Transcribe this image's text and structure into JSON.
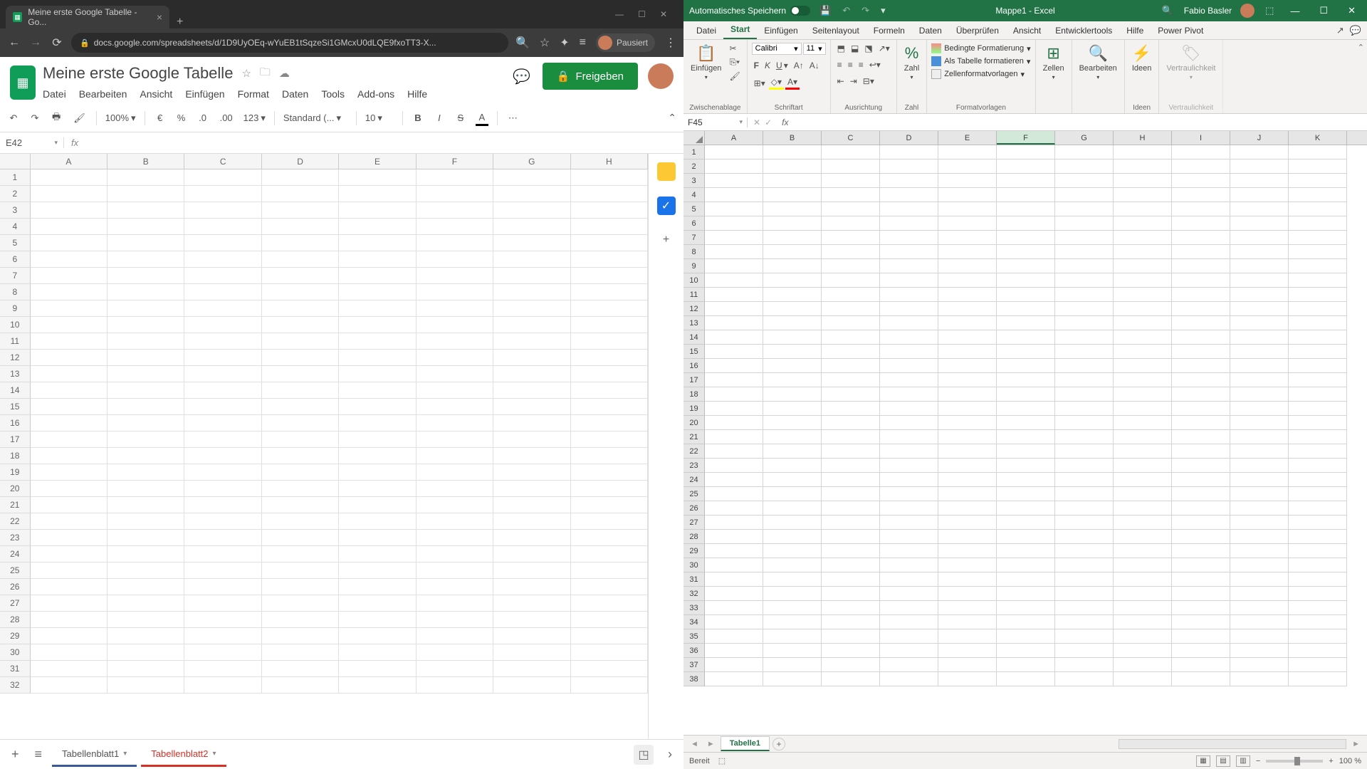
{
  "chrome": {
    "tab_title": "Meine erste Google Tabelle - Go...",
    "url": "docs.google.com/spreadsheets/d/1D9UyOEq-wYuEB1tSqzeSi1GMcxU0dLQE9fxoTT3-X...",
    "pausiert": "Pausiert"
  },
  "gs": {
    "title": "Meine erste Google Tabelle",
    "menus": [
      "Datei",
      "Bearbeiten",
      "Ansicht",
      "Einfügen",
      "Format",
      "Daten",
      "Tools",
      "Add-ons",
      "Hilfe"
    ],
    "share": "Freigeben",
    "toolbar": {
      "zoom": "100%",
      "currency": "€",
      "percent": "%",
      "dec_dec": ".0",
      "inc_dec": ".00",
      "numfmt": "123",
      "fontfmt": "Standard (...",
      "fontsize": "10"
    },
    "namebox": "E42",
    "cols": [
      "A",
      "B",
      "C",
      "D",
      "E",
      "F",
      "G",
      "H"
    ],
    "rows": 32,
    "sheet_tabs": [
      "Tabellenblatt1",
      "Tabellenblatt2"
    ]
  },
  "xl": {
    "autosave": "Automatisches Speichern",
    "doc_title": "Mappe1 - Excel",
    "user": "Fabio Basler",
    "ribbon_tabs": [
      "Datei",
      "Start",
      "Einfügen",
      "Seitenlayout",
      "Formeln",
      "Daten",
      "Überprüfen",
      "Ansicht",
      "Entwicklertools",
      "Hilfe",
      "Power Pivot"
    ],
    "active_tab": "Start",
    "groups": {
      "clipboard": {
        "label": "Zwischenablage",
        "paste": "Einfügen"
      },
      "font": {
        "label": "Schriftart",
        "name": "Calibri",
        "size": "11"
      },
      "align": {
        "label": "Ausrichtung"
      },
      "number": {
        "label": "Zahl",
        "btn": "Zahl"
      },
      "styles": {
        "label": "Formatvorlagen",
        "cond": "Bedingte Formatierung",
        "table": "Als Tabelle formatieren",
        "cell": "Zellenformatvorlagen"
      },
      "cells": {
        "label": "",
        "btn": "Zellen"
      },
      "editing": {
        "label": "",
        "btn": "Bearbeiten"
      },
      "ideas": {
        "label": "Ideen",
        "btn": "Ideen"
      },
      "sens": {
        "label": "Vertraulichkeit",
        "btn": "Vertraulichkeit"
      }
    },
    "namebox": "F45",
    "cols": [
      "A",
      "B",
      "C",
      "D",
      "E",
      "F",
      "G",
      "H",
      "I",
      "J",
      "K"
    ],
    "sel_col": "F",
    "rows": 38,
    "sheet_tab": "Tabelle1",
    "status": "Bereit",
    "zoom": "100 %"
  }
}
